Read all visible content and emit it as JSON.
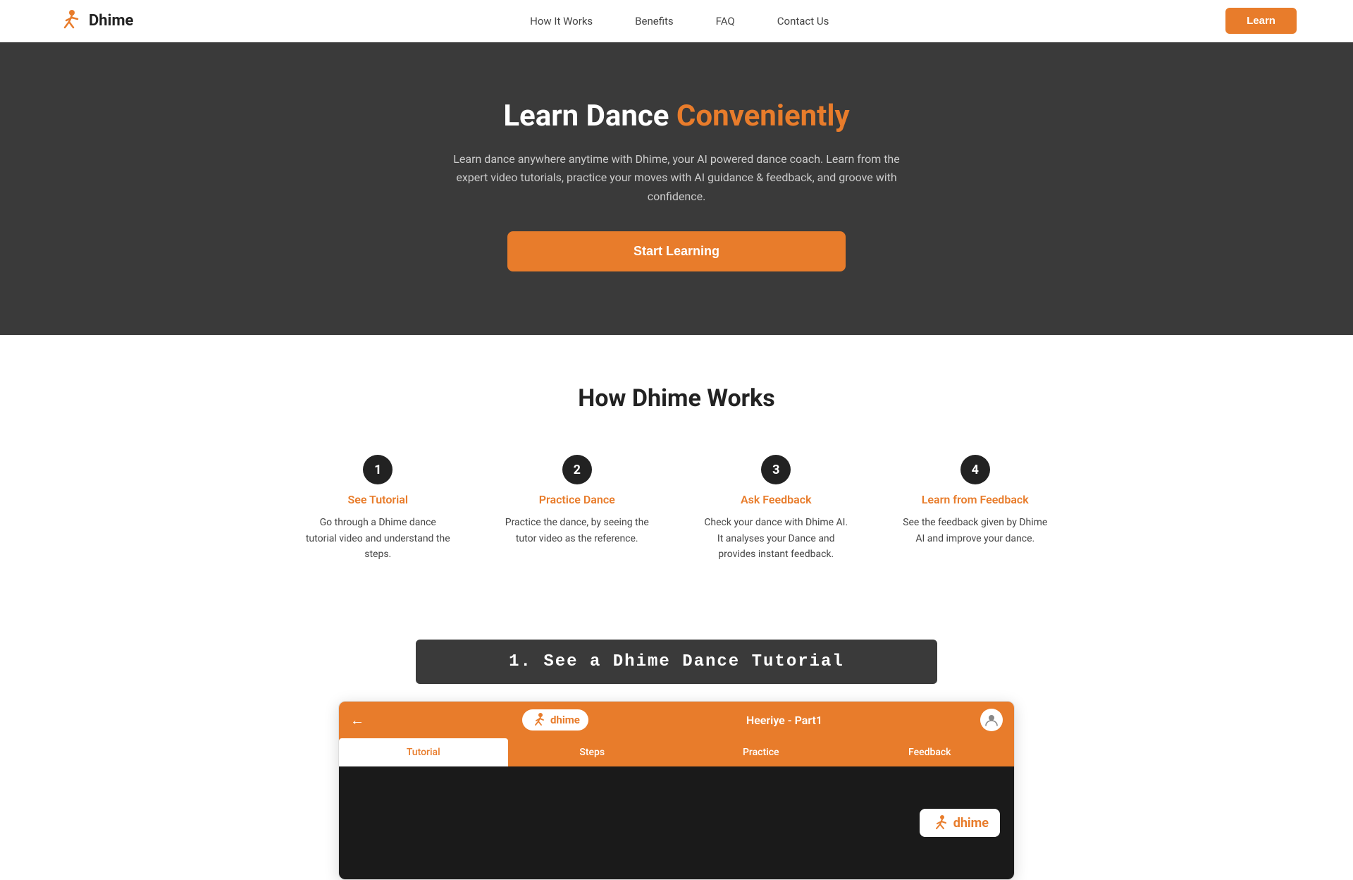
{
  "brand": {
    "name": "Dhime",
    "logo_alt": "Dhime Logo"
  },
  "nav": {
    "links": [
      {
        "id": "how-it-works",
        "label": "How It Works"
      },
      {
        "id": "benefits",
        "label": "Benefits"
      },
      {
        "id": "faq",
        "label": "FAQ"
      },
      {
        "id": "contact",
        "label": "Contact Us"
      }
    ],
    "cta_label": "Learn"
  },
  "hero": {
    "title_plain": "Learn Dance ",
    "title_highlight": "Conveniently",
    "description": "Learn dance anywhere anytime with Dhime, your AI powered dance coach. Learn from the expert video tutorials, practice your moves with AI guidance & feedback, and groove with confidence.",
    "cta_label": "Start Learning"
  },
  "how_section": {
    "title": "How Dhime Works",
    "steps": [
      {
        "number": "1",
        "title": "See Tutorial",
        "description": "Go through a Dhime dance tutorial video and understand the steps."
      },
      {
        "number": "2",
        "title": "Practice Dance",
        "description": "Practice the dance, by seeing the tutor video as the reference."
      },
      {
        "number": "3",
        "title": "Ask Feedback",
        "description": "Check your dance with Dhime AI. It analyses your Dance and provides instant feedback."
      },
      {
        "number": "4",
        "title": "Learn from Feedback",
        "description": "See the feedback given by Dhime AI and improve your dance."
      }
    ]
  },
  "tutorial_section": {
    "banner_text": "1. See a Dhime Dance Tutorial"
  },
  "app_mockup": {
    "back_icon": "←",
    "logo_text": "dhime",
    "song_title": "Heeriye - Part1",
    "tabs": [
      {
        "label": "Tutorial",
        "active": true
      },
      {
        "label": "Steps",
        "active": false
      },
      {
        "label": "Practice",
        "active": false
      },
      {
        "label": "Feedback",
        "active": false
      }
    ],
    "watermark_text": "dhime"
  },
  "colors": {
    "orange": "#e87c2b",
    "dark_bg": "#3a3a3a",
    "dark_app": "#1a1a1a",
    "text_dark": "#222222",
    "text_muted": "#cccccc",
    "text_step": "#444444"
  }
}
